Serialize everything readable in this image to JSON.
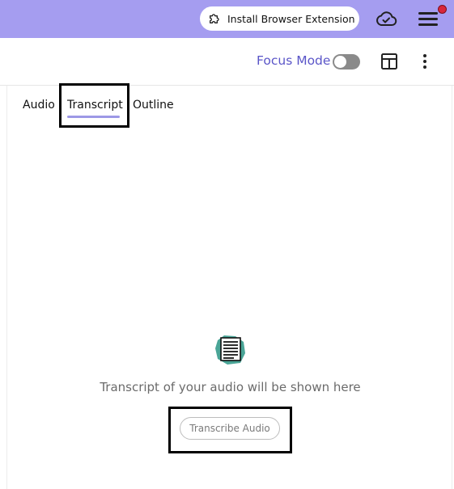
{
  "header": {
    "install_extension_label": "Install Browser Extension",
    "icons": [
      "puzzle-icon",
      "cloud-check-icon",
      "hamburger-menu-icon"
    ],
    "notification_dot_color": "#d8263b",
    "bar_color": "#a59df0"
  },
  "toolbar": {
    "focus_mode_label": "Focus Mode",
    "focus_mode_enabled": false,
    "accent_color": "#5a55c8",
    "icons": [
      "layout-icon",
      "more-vertical-icon"
    ]
  },
  "tabs": [
    {
      "label": "Audio",
      "active": false
    },
    {
      "label": "Transcript",
      "active": true
    },
    {
      "label": "Outline",
      "active": false
    }
  ],
  "empty_state": {
    "icon": "document-icon",
    "message": "Transcript of your audio will be shown here",
    "button_label": "Transcribe Audio"
  }
}
